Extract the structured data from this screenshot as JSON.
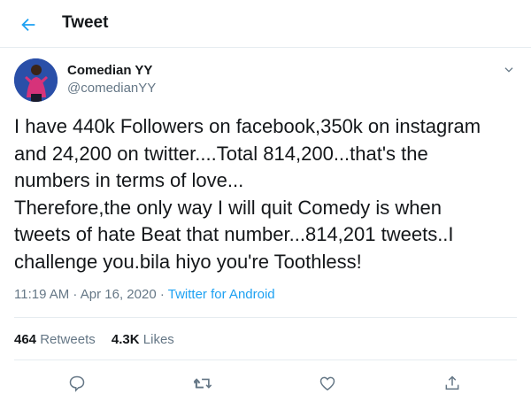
{
  "header": {
    "title": "Tweet",
    "back_icon": "back-arrow-icon"
  },
  "author": {
    "name": "Comedian YY",
    "handle": "@comedianYY",
    "avatar_color": "#2a4fa8"
  },
  "tweet": {
    "text": "I have 440k Followers on facebook,350k on instagram\nand 24,200 on twitter....Total 814,200...that's the\nnumbers in terms of love...\nTherefore,the only way I will quit Comedy is when\ntweets of hate Beat that number...814,201 tweets..I\nchallenge you.bila hiyo you're Toothless!"
  },
  "meta": {
    "time": "11:19 AM",
    "sep1": " · ",
    "date": "Apr 16, 2020",
    "sep2": " · ",
    "source": "Twitter for Android"
  },
  "stats": {
    "retweets_count": "464",
    "retweets_label": "Retweets",
    "likes_count": "4.3K",
    "likes_label": "Likes"
  },
  "colors": {
    "accent": "#1da1f2",
    "muted": "#657786",
    "text": "#14171a",
    "border": "#e6ecf0"
  },
  "actions": [
    "reply-icon",
    "retweet-icon",
    "like-icon",
    "share-icon"
  ]
}
